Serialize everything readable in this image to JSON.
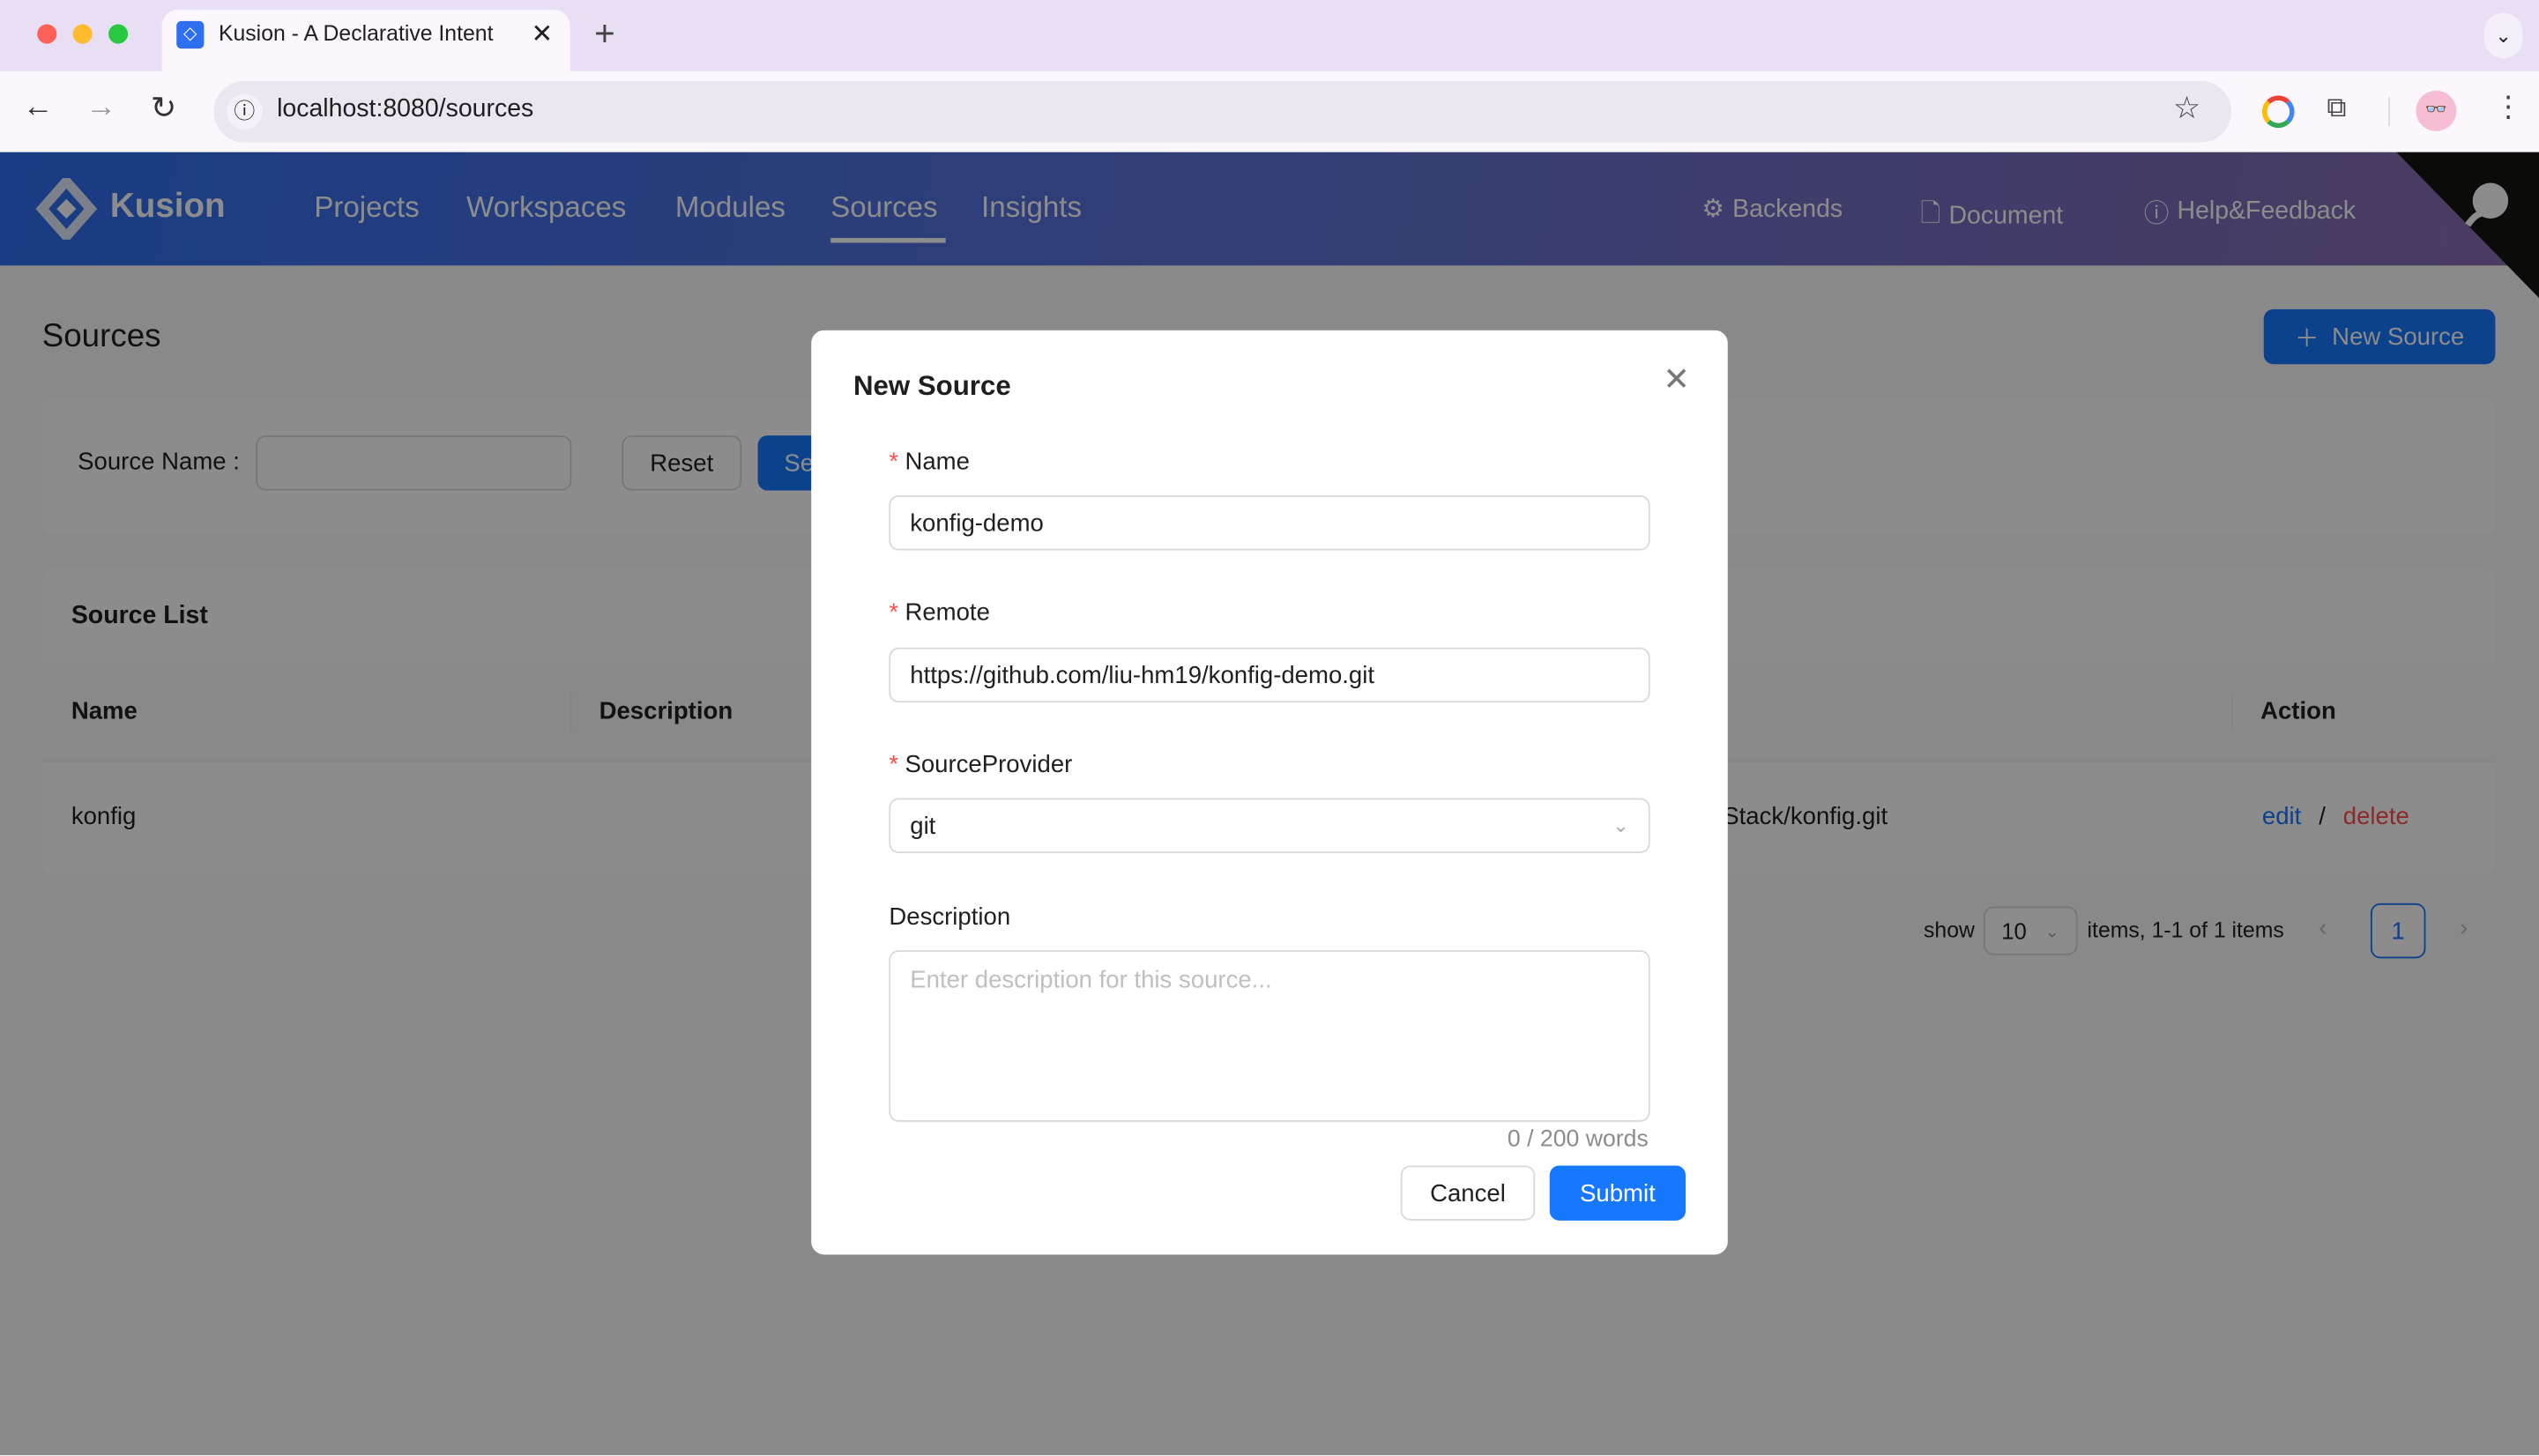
{
  "browser": {
    "tab_title": "Kusion - A Declarative Intent",
    "url": "localhost:8080/sources"
  },
  "header": {
    "logo": "Kusion",
    "nav": [
      {
        "label": "Projects"
      },
      {
        "label": "Workspaces"
      },
      {
        "label": "Modules"
      },
      {
        "label": "Sources",
        "active": true
      },
      {
        "label": "Insights"
      }
    ],
    "links": [
      {
        "label": "Backends",
        "icon": "gear-icon"
      },
      {
        "label": "Document",
        "icon": "file-icon"
      },
      {
        "label": "Help&Feedback",
        "icon": "question-circle-icon"
      }
    ]
  },
  "page": {
    "title": "Sources",
    "new_button": "New Source",
    "search": {
      "label": "Source Name",
      "reset": "Reset",
      "search": "Search"
    },
    "list": {
      "title": "Source List",
      "columns": [
        "Name",
        "Description",
        "Action"
      ],
      "rows": [
        {
          "name": "konfig",
          "remote": "Stack/konfig.git",
          "edit": "edit",
          "sep": "/",
          "delete": "delete"
        }
      ]
    },
    "pagination": {
      "show": "show",
      "page_size": "10",
      "summary": "items, 1-1 of 1 items",
      "current_page": "1"
    }
  },
  "modal": {
    "title": "New Source",
    "fields": {
      "name": {
        "label": "Name",
        "value": "konfig-demo",
        "required": true
      },
      "remote": {
        "label": "Remote",
        "value": "https://github.com/liu-hm19/konfig-demo.git",
        "required": true
      },
      "provider": {
        "label": "SourceProvider",
        "value": "git",
        "required": true
      },
      "description": {
        "label": "Description",
        "placeholder": "Enter description for this source...",
        "counter": "0 / 200 words"
      }
    },
    "cancel": "Cancel",
    "submit": "Submit"
  },
  "colors": {
    "primary": "#1677ff",
    "danger": "#ff4d4f",
    "required": "#ff4d4f"
  }
}
